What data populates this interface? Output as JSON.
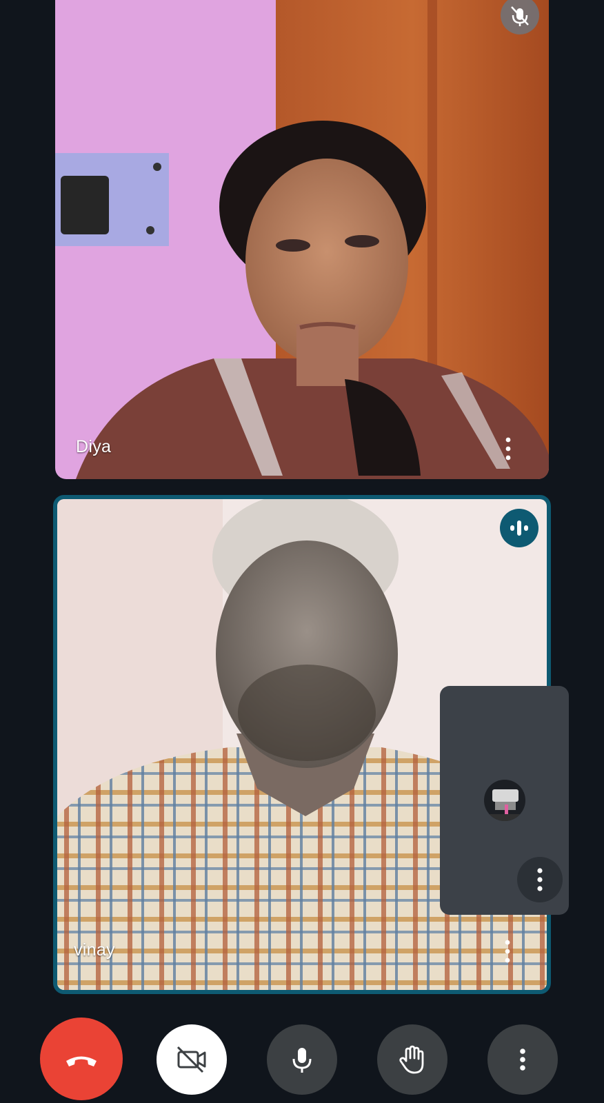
{
  "participants": [
    {
      "name": "Diya",
      "muted": true
    },
    {
      "name": "vinay",
      "speaking": true
    }
  ],
  "icons": {
    "mute": "mic-off-icon",
    "speaking": "audio-level-icon",
    "options": "more-vert-icon",
    "end_call": "call-end-icon",
    "camera": "videocam-off-icon",
    "mic": "mic-icon",
    "hand": "raise-hand-icon",
    "more": "more-vert-icon"
  },
  "colors": {
    "background": "#10151c",
    "end_call": "#ea4335",
    "active_speaker": "#0e5a72",
    "control_button": "#3c4043"
  }
}
